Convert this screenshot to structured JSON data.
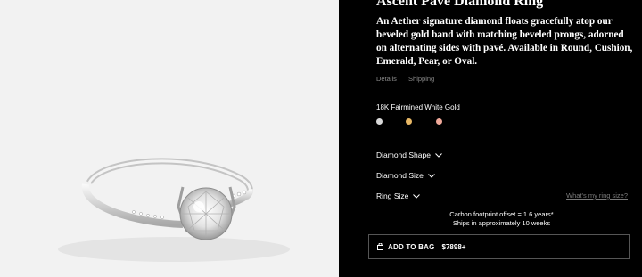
{
  "product": {
    "title": "Ascent Pavé Diamond Ring",
    "description": "An Aether signature diamond floats gracefully atop our beveled gold band with matching beveled prongs, adorned on alternating sides with pavé.  Available in Round, Cushion, Emerald, Pear, or Oval."
  },
  "tabs": [
    {
      "label": "Details"
    },
    {
      "label": "Shipping"
    }
  ],
  "metal": {
    "selected_label": "18K Fairmined White Gold",
    "swatches": [
      {
        "name": "white-gold",
        "color": "#d9d9d9"
      },
      {
        "name": "yellow-gold",
        "color": "#e8b866"
      },
      {
        "name": "rose-gold",
        "color": "#f0a99a"
      }
    ]
  },
  "options": {
    "diamond_shape": "Diamond Shape",
    "diamond_size": "Diamond Size",
    "ring_size": "Ring Size",
    "ring_size_link": "What's my ring size?"
  },
  "carbon": {
    "line1": "Carbon footprint offset = 1.6 years*",
    "line2": "Ships in approximately 10 weeks"
  },
  "cart": {
    "label": "ADD TO BAG",
    "price": "$7898+"
  },
  "colors": {
    "panel_bg": "#000000",
    "image_bg": "#f2f2f2",
    "muted_text": "#8a8a8a"
  }
}
